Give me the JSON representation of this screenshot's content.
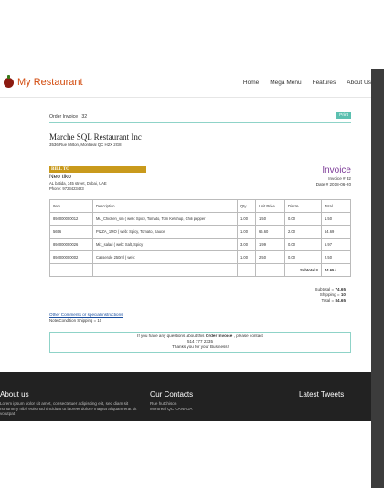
{
  "brand": {
    "name": "My Restaurant",
    "icon": "tomato-logo-icon"
  },
  "nav": {
    "items": [
      "Home",
      "Mega Menu",
      "Features",
      "About Us"
    ]
  },
  "invoice_header": {
    "title": "Order Invoice | 32",
    "print_label": "Print"
  },
  "company": {
    "name": "Marche SQL Restaurant Inc",
    "address": "3536 Rue Milton, Montreal QC H2X 2G8"
  },
  "bill_to": {
    "label": "BILL TO",
    "name": "Neo tiko",
    "address": "AL batida, 345 street, Dubai, UAE",
    "phone": "Phone: 9723423423"
  },
  "invoice_meta": {
    "word": "Invoice",
    "number_text": "Invoice # 32",
    "date_text": "Date # 2018-06-20"
  },
  "table": {
    "headers": [
      "Item",
      "Description",
      "Qty",
      "Unit Price",
      "Disc%",
      "Total"
    ],
    "rows": [
      [
        "894000000012",
        "Mu_Chicken_sm ( web: Spicy, Tomato, Tom Ketchup, Chili pepper",
        "1.00",
        "1.50",
        "0.00",
        "1.50"
      ],
      [
        "5656",
        "PIZZA_1MO ( web: Spicy, Tomato, Sauce",
        "1.00",
        "66.60",
        "2.00",
        "64.69"
      ],
      [
        "894000000026",
        "Mix_salad ( web: Salt, Spicy",
        "3.00",
        "1.99",
        "0.00",
        "5.97"
      ],
      [
        "894000000002",
        "Casserole 250ml ( web:",
        "1.00",
        "2.50",
        "0.00",
        "2.50"
      ]
    ],
    "subtotal_label": "Subtotal =",
    "subtotal_value": "74.65 /."
  },
  "totals": {
    "subtotal_label": "Subtotal =",
    "subtotal_value": "74.65",
    "shipping_label": "Shipping =",
    "shipping_value": "10",
    "total_label": "Total =",
    "total_value": "84.65"
  },
  "comments": {
    "link": "Other Comments or special instructions",
    "note": "Note/Condition Shipping = 10"
  },
  "thanks": {
    "line1_pre": "If you have any questions about this ",
    "line1_bold": "Order Invoice",
    "line1_post": " , please contact",
    "phone": "514 777 2335",
    "line3": "Thanks you for your Business!"
  },
  "footer": {
    "about_title": "About us",
    "about_text": "Lorem ipsum dolor sit amet, consectetuer adipiscing elit, sed diam sit nonummy nibh euismod tincidunt ut laoreet dolore magna aliquam erat sit volutpat",
    "contacts_title": "Our Contacts",
    "contact_name": "Rue hutchison",
    "contact_city": "Montreal QC CANADA",
    "tweets_title": "Latest Tweets"
  },
  "colors": {
    "brand": "#d24a0d",
    "accent": "#5bc0b0",
    "bill_to": "#c99a1c",
    "invoice_word": "#7d3c98",
    "footer": "#222222"
  }
}
